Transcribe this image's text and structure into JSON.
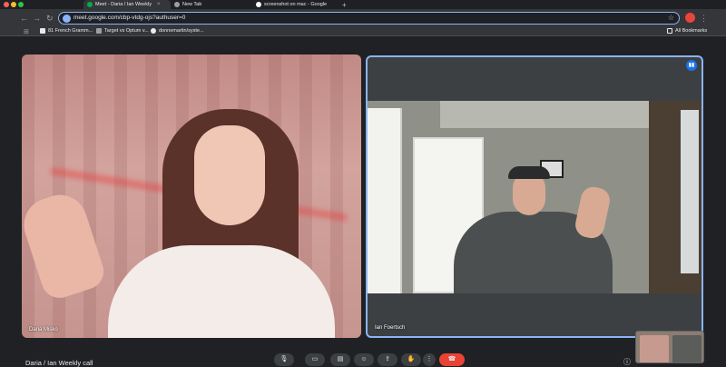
{
  "browser": {
    "tabs": [
      {
        "label": "Meet - Daria / Ian Weekly"
      },
      {
        "label": "New Tab"
      },
      {
        "label": "screenshot on mac - Google"
      }
    ],
    "url": "meet.google.com/cbp-vtdg-ojs?authuser=0",
    "profile_initial": "",
    "bookmarks": [
      {
        "label": "81 French Gramm..."
      },
      {
        "label": "Target vs Optum v..."
      },
      {
        "label": "donnemartin/syste..."
      }
    ],
    "all_bookmarks": "All Bookmarks"
  },
  "meeting": {
    "title": "Daria / Ian Weekly call",
    "participants": [
      {
        "name": "Daria Misko"
      },
      {
        "name": "Ian Foertsch"
      }
    ]
  },
  "colors": {
    "accent": "#8ab4f8",
    "end_call": "#ea4335",
    "background": "#202124"
  }
}
